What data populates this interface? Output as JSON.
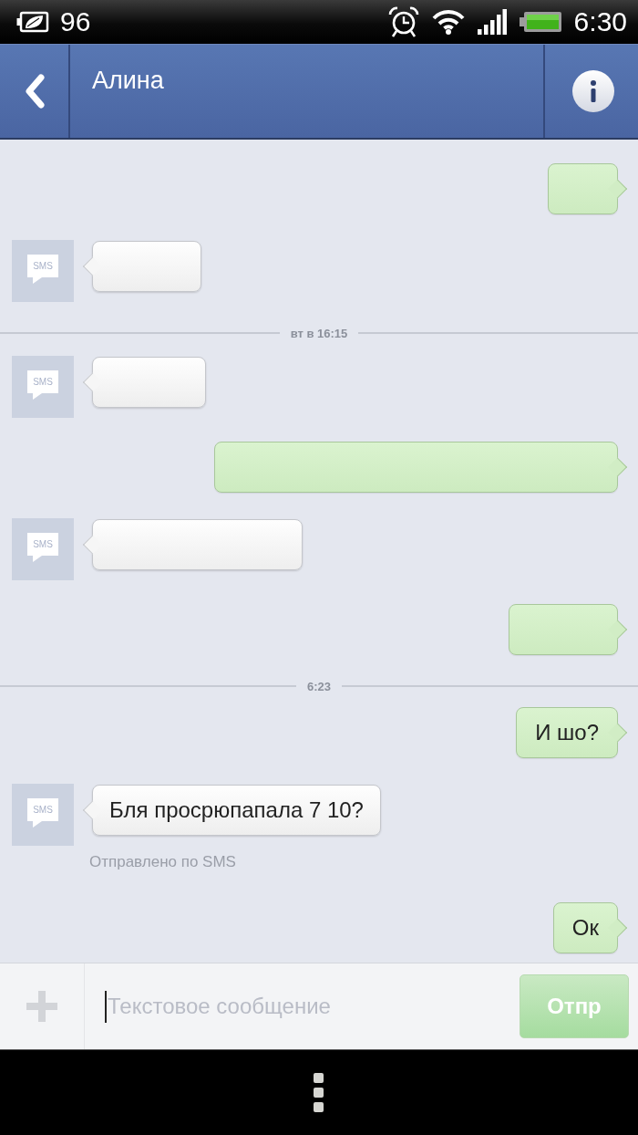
{
  "status_bar": {
    "indicator_text": "96",
    "time": "6:30"
  },
  "header": {
    "title": "Алина"
  },
  "thread": [
    {
      "kind": "sent"
    },
    {
      "kind": "received",
      "avatar_label": "SMS"
    },
    {
      "kind": "divider",
      "label": "вт в 16:15"
    },
    {
      "kind": "received",
      "avatar_label": "SMS"
    },
    {
      "kind": "sent"
    },
    {
      "kind": "received",
      "avatar_label": "SMS"
    },
    {
      "kind": "sent"
    },
    {
      "kind": "divider",
      "label": "6:23"
    },
    {
      "kind": "sent",
      "text": "И шо?"
    },
    {
      "kind": "received",
      "avatar_label": "SMS",
      "text": "Бля просрюпапала 7 10?",
      "note": "Отправлено по SMS"
    },
    {
      "kind": "sent",
      "text": "Ок"
    }
  ],
  "composer": {
    "placeholder": "Текстовое сообщение",
    "focused": true,
    "send_button": {
      "label": "Отпр",
      "disabled": true
    }
  }
}
